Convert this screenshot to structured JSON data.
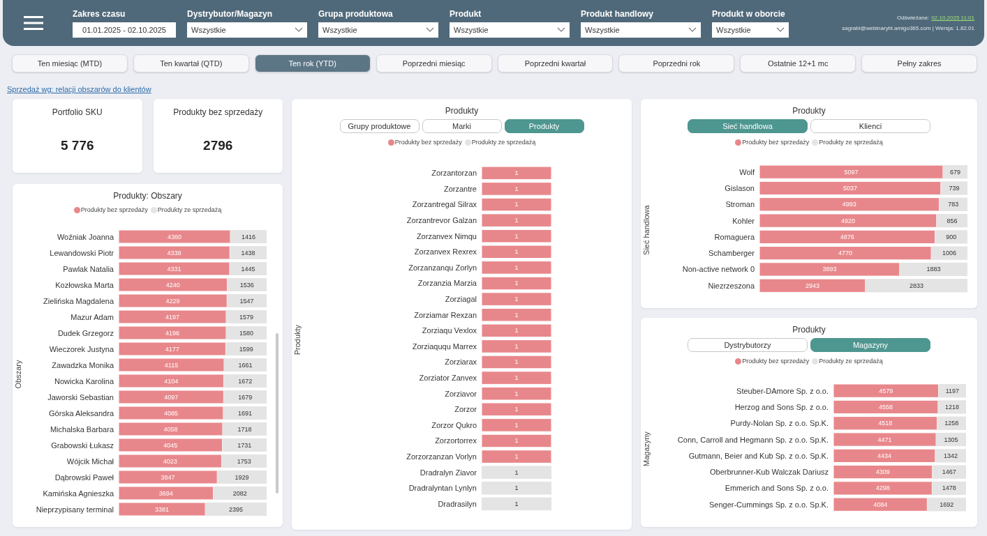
{
  "header": {
    "filters": [
      {
        "label": "Zakres czasu",
        "value": "01.01.2025 - 02.10.2025",
        "kind": "date"
      },
      {
        "label": "Dystrybutor/Magazyn",
        "value": "Wszystkie",
        "kind": "dropdown"
      },
      {
        "label": "Grupa produktowa",
        "value": "Wszystkie",
        "kind": "dropdown"
      },
      {
        "label": "Produkt",
        "value": "Wszystkie",
        "kind": "dropdown"
      },
      {
        "label": "Produkt handlowy",
        "value": "Wszystkie",
        "kind": "dropdown"
      },
      {
        "label": "Produkt w oborcie",
        "value": "Wszystkie",
        "kind": "dropdown"
      }
    ],
    "refresh_label": "Odświeżane:",
    "refresh_time": "02.10.2025 11:01",
    "user_info": "sagrabi@webinarybi.amigo365.com | Wersja: 1.82.01"
  },
  "period_tabs": [
    {
      "label": "Ten miesiąc (MTD)",
      "selected": false
    },
    {
      "label": "Ten kwartał (QTD)",
      "selected": false
    },
    {
      "label": "Ten rok (YTD)",
      "selected": true
    },
    {
      "label": "Poprzedni miesiąc",
      "selected": false
    },
    {
      "label": "Poprzedni kwartał",
      "selected": false
    },
    {
      "label": "Poprzedni rok",
      "selected": false
    },
    {
      "label": "Ostatnie 12+1 mc",
      "selected": false
    },
    {
      "label": "Pełny zakres",
      "selected": false
    }
  ],
  "breadcrumb_link": "Sprzedaż wg: relacji obszarów do klientów",
  "kpis": [
    {
      "label": "Portfolio SKU",
      "value": "5 776"
    },
    {
      "label": "Produkty bez sprzedaży",
      "value": "2796"
    }
  ],
  "panels": [
    {
      "title": "Produkty: Obszary",
      "chart_data": {
        "type": "bar",
        "orientation": "horizontal",
        "stacked": true,
        "data_labels": true,
        "ylabel": "Obszary",
        "xlim": [
          0,
          5776
        ],
        "categories": [
          "Woźniak Joanna",
          "Lewandowski Piotr",
          "Pawlak Natalia",
          "Kozłowska Marta",
          "Zielińska Magdalena",
          "Mazur Adam",
          "Dudek Grzegorz",
          "Wieczorek Justyna",
          "Zawadzka Monika",
          "Nowicka Karolina",
          "Jaworski Sebastian",
          "Górska Aleksandra",
          "Michalska Barbara",
          "Grabowski Łukasz",
          "Wójcik Michał",
          "Dąbrowski Paweł",
          "Kamińska Agnieszka",
          "Nieprzypisany terminal"
        ],
        "series": [
          {
            "name": "Produkty bez sprzedaży",
            "color": "#e8878b",
            "values": [
              4360,
              4338,
              4331,
              4240,
              4229,
              4197,
              4196,
              4177,
              4115,
              4104,
              4097,
              4085,
              4058,
              4045,
              4023,
              3847,
              3694,
              3381
            ]
          },
          {
            "name": "Produkty ze sprzedażą",
            "color": "#e4e4e4",
            "values": [
              1416,
              1438,
              1445,
              1536,
              1547,
              1579,
              1580,
              1599,
              1661,
              1672,
              1679,
              1691,
              1718,
              1731,
              1753,
              1929,
              2082,
              2395
            ]
          }
        ]
      }
    },
    {
      "title": "Produkty",
      "toggles": [
        {
          "label": "Grupy produktowe",
          "selected": false
        },
        {
          "label": "Marki",
          "selected": false
        },
        {
          "label": "Produkty",
          "selected": true
        }
      ],
      "chart_data": {
        "type": "bar",
        "orientation": "horizontal",
        "stacked": true,
        "data_labels": true,
        "ylabel": "Produkty",
        "categories": [
          "Zorzantorzan",
          "Zorzantre",
          "Zorzantregal Silrax",
          "Zorzantrevor Galzan",
          "Zorzanvex Nimqu",
          "Zorzanvex Rexrex",
          "Zorzanzanqu Zorlyn",
          "Zorzanzia Marzia",
          "Zorziagal",
          "Zorziamar Rexzan",
          "Zorziaqu Vexlox",
          "Zorziaququ Marrex",
          "Zorziarax",
          "Zorziator Zanvex",
          "Zorziavor",
          "Zorzor",
          "Zorzor Qukro",
          "Zorzortorrex",
          "Zorzorzanzan Vorlyn",
          "Dradralyn Ziavor",
          "Dradralyntan Lynlyn",
          "Dradrasilyn"
        ],
        "series": [
          {
            "name": "Produkty bez sprzedaży",
            "color": "#e8878b",
            "values": [
              1,
              1,
              1,
              1,
              1,
              1,
              1,
              1,
              1,
              1,
              1,
              1,
              1,
              1,
              1,
              1,
              1,
              1,
              1,
              null,
              null,
              null
            ]
          },
          {
            "name": "Produkty ze sprzedażą",
            "color": "#e4e4e4",
            "values": [
              null,
              null,
              null,
              null,
              null,
              null,
              null,
              null,
              null,
              null,
              null,
              null,
              null,
              null,
              null,
              null,
              null,
              null,
              null,
              1,
              1,
              1
            ]
          }
        ]
      }
    },
    {
      "title": "Produkty",
      "toggles": [
        {
          "label": "Sieć handlowa",
          "selected": true
        },
        {
          "label": "Klienci",
          "selected": false
        }
      ],
      "chart_data": {
        "type": "bar",
        "orientation": "horizontal",
        "stacked": true,
        "data_labels": true,
        "ylabel": "Sieć handlowa",
        "xlim": [
          0,
          5776
        ],
        "categories": [
          "Wolf",
          "Gislason",
          "Stroman",
          "Kohler",
          "Romaguera",
          "Schamberger",
          "Non-active network 0",
          "Niezrzeszona"
        ],
        "series": [
          {
            "name": "Produkty bez sprzedaży",
            "color": "#e8878b",
            "values": [
              5097,
              5037,
              4993,
              4920,
              4876,
              4770,
              3893,
              2943
            ]
          },
          {
            "name": "Produkty ze sprzedażą",
            "color": "#e4e4e4",
            "values": [
              679,
              739,
              783,
              856,
              900,
              1006,
              1883,
              2833
            ]
          }
        ]
      }
    },
    {
      "title": "Produkty",
      "toggles": [
        {
          "label": "Dystrybutorzy",
          "selected": false
        },
        {
          "label": "Magazyny",
          "selected": true
        }
      ],
      "chart_data": {
        "type": "bar",
        "orientation": "horizontal",
        "stacked": true,
        "data_labels": true,
        "ylabel": "Magazyny",
        "xlim": [
          0,
          5776
        ],
        "categories": [
          "Steuber-DAmore Sp. z o.o.",
          "Herzog and Sons Sp. z o.o.",
          "Purdy-Nolan Sp. z o.o. Sp.K.",
          "Conn, Carroll and Hegmann Sp. z o.o. Sp.K.",
          "Gutmann, Beier and Kub Sp. z o.o. Sp.K.",
          "Oberbrunner-Kub Walczak Dariusz",
          "Emmerich and Sons Sp. z o.o.",
          "Senger-Cummings Sp. z o.o. Sp.K."
        ],
        "series": [
          {
            "name": "Produkty bez sprzedaży",
            "color": "#e8878b",
            "values": [
              4579,
              4558,
              4518,
              4471,
              4434,
              4309,
              4298,
              4084
            ]
          },
          {
            "name": "Produkty ze sprzedażą",
            "color": "#e4e4e4",
            "values": [
              1197,
              1218,
              1258,
              1305,
              1342,
              1467,
              1478,
              1692
            ]
          }
        ]
      }
    }
  ]
}
